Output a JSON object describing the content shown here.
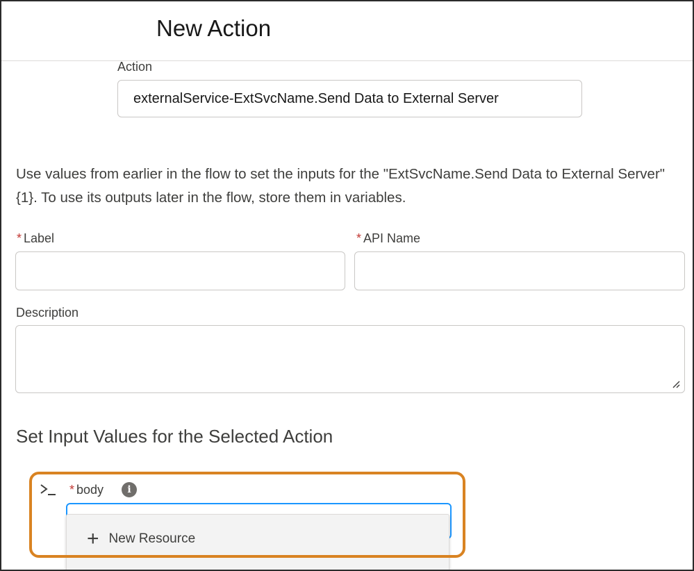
{
  "header": {
    "title": "New Action"
  },
  "action": {
    "label": "Action",
    "value": "externalService-ExtSvcName.Send Data to External Server"
  },
  "help_text": "Use values from earlier in the flow to set the inputs for the \"ExtSvcName.Send Data to External Server\" {1}. To use its outputs later in the flow, store them in variables.",
  "fields": {
    "required_marker": "*",
    "label": {
      "label": "Label",
      "value": ""
    },
    "api_name": {
      "label": "API Name",
      "value": ""
    },
    "description": {
      "label": "Description",
      "value": ""
    }
  },
  "section": {
    "title": "Set Input Values for the Selected Action"
  },
  "input_body": {
    "label": "body",
    "value": ""
  },
  "dropdown": {
    "items": [
      {
        "icon": "plus-icon",
        "label": "New Resource"
      }
    ]
  },
  "icons": {
    "command": "command-prompt-icon",
    "info": "info-icon",
    "info_glyph": "i"
  },
  "colors": {
    "accent_focus": "#1b96ff",
    "highlight": "#d98322",
    "required": "#c23934"
  }
}
